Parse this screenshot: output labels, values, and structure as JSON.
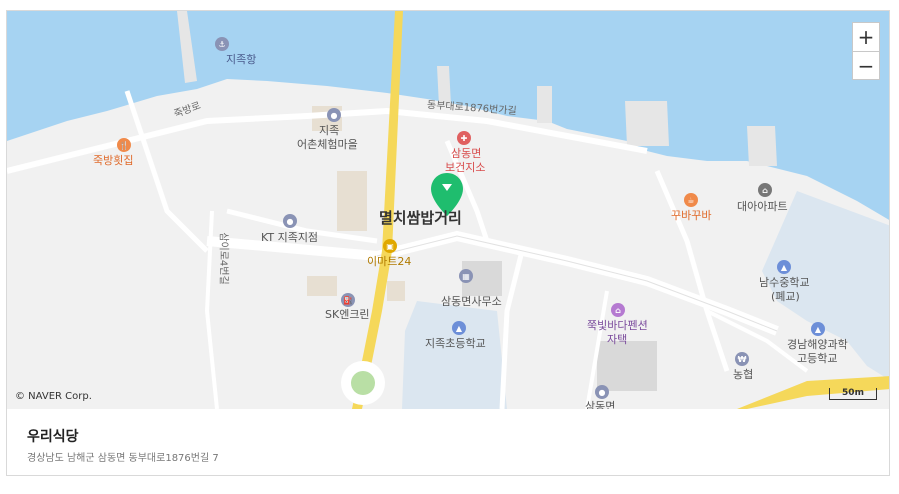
{
  "map": {
    "attribution": "© NAVER Corp.",
    "scale_label": "50m",
    "zoom": {
      "in_label": "+",
      "out_label": "−"
    },
    "selected_place": "멸치쌈밥거리",
    "labels": {
      "jijokhang": "지족항",
      "jukbangro": "죽방로",
      "jijok_village_1": "지족",
      "jijok_village_2": "어촌체험마을",
      "jukbang": "죽방횟집",
      "road_1876": "동부대로1876번가길",
      "health_1": "삼동면",
      "health_2": "보건지소",
      "kt": "KT 지족지점",
      "samilro": "삼이로4번길",
      "emart": "이마트24",
      "sk": "SK엔크린",
      "office": "삼동면사무소",
      "school": "지족초등학교",
      "pension_1": "쭉빛바다펜션",
      "pension_2": "자택",
      "kkuba": "꾸바꾸바",
      "daea": "대아아파트",
      "namsu_1": "남수중학교",
      "namsu_2": "(폐교)",
      "gyeongnam_1": "경남해양과학",
      "gyeongnam_2": "고등학교",
      "nh": "농협",
      "samdong_bottom": "삼동면"
    },
    "colors": {
      "sea": "#a6d3f2",
      "land": "#f2f2f2",
      "road": "#ffffff",
      "main_road": "#f5d85a",
      "marker": "#1fbd6e"
    }
  },
  "place": {
    "name": "우리식당",
    "address": "경상남도 남해군 삼동면 동부대로1876번길 7"
  }
}
